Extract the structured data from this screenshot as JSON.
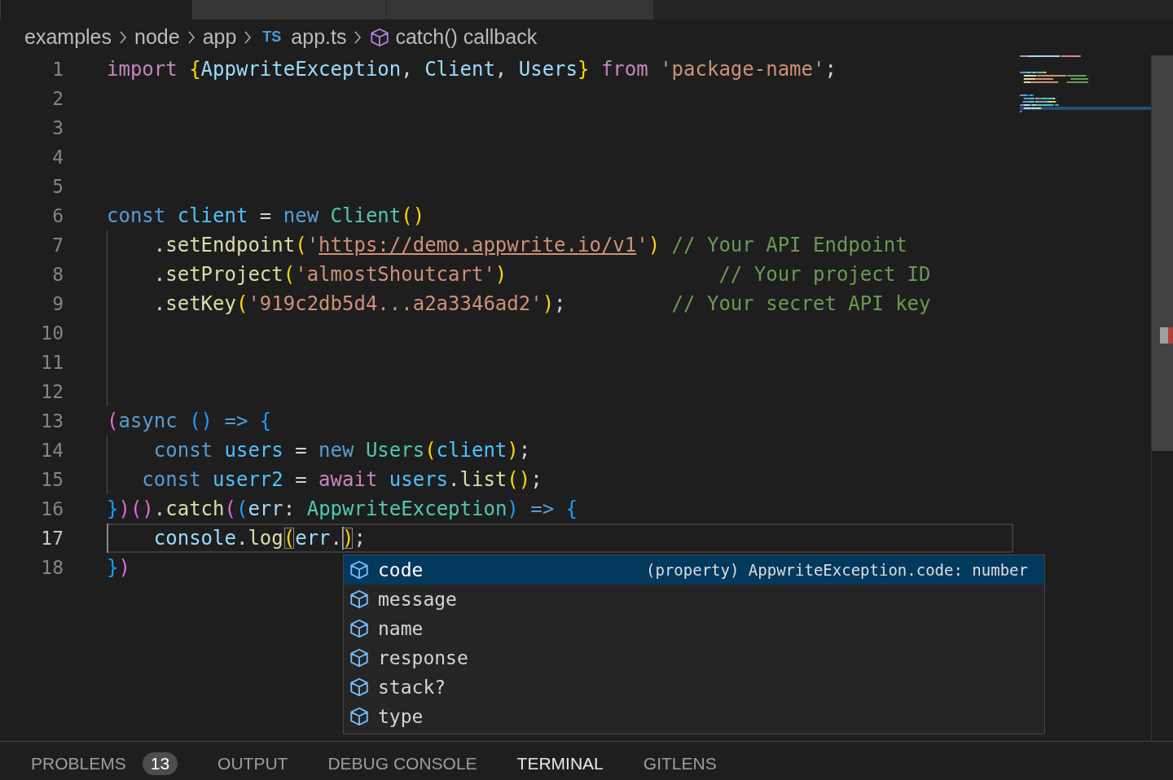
{
  "editor_tabs": [
    {
      "selected": true
    },
    {
      "selected": false
    },
    {
      "selected": false
    }
  ],
  "breadcrumb": [
    {
      "kind": "folder",
      "label": "examples"
    },
    {
      "kind": "folder",
      "label": "node"
    },
    {
      "kind": "folder",
      "label": "app"
    },
    {
      "kind": "file",
      "badge": "TS",
      "label": "app.ts"
    },
    {
      "kind": "symbol",
      "label": "catch() callback"
    }
  ],
  "editor": {
    "lines": [
      {
        "number": "1",
        "current": false,
        "guide": false,
        "tokens": [
          {
            "t": "import ",
            "color": "#c586c0"
          },
          {
            "t": "{",
            "color": "#ffd700"
          },
          {
            "t": "AppwriteException",
            "color": "#9cdcfe"
          },
          {
            "t": ", ",
            "color": "#d4d4d4"
          },
          {
            "t": "Client",
            "color": "#9cdcfe"
          },
          {
            "t": ", ",
            "color": "#d4d4d4"
          },
          {
            "t": "Users",
            "color": "#9cdcfe"
          },
          {
            "t": "}",
            "color": "#ffd700"
          },
          {
            "t": " from ",
            "color": "#c586c0"
          },
          {
            "t": "'package-name'",
            "color": "#ce9178"
          },
          {
            "t": ";",
            "color": "#d4d4d4"
          }
        ]
      },
      {
        "number": "2",
        "current": false,
        "guide": false
      },
      {
        "number": "3",
        "current": false,
        "guide": false
      },
      {
        "number": "4",
        "current": false,
        "guide": false
      },
      {
        "number": "5",
        "current": false,
        "guide": false
      },
      {
        "number": "6",
        "current": false,
        "guide": false,
        "tokens": [
          {
            "t": "const ",
            "color": "#569cd6"
          },
          {
            "t": "client",
            "color": "#4fc1ff"
          },
          {
            "t": " = ",
            "color": "#d4d4d4"
          },
          {
            "t": "new ",
            "color": "#569cd6"
          },
          {
            "t": "Client",
            "color": "#4ec9b0"
          },
          {
            "t": "()",
            "color": "#ffd700"
          }
        ]
      },
      {
        "number": "7",
        "current": false,
        "guide": true,
        "tokens": [
          {
            "t": "    .setEndpoint",
            "color": "#dcdcaa"
          },
          {
            "t": "(",
            "color": "#ffd700"
          },
          {
            "t": "'",
            "color": "#ce9178"
          },
          {
            "t": "https://demo.appwrite.io/v1",
            "color": "#ce9178",
            "underline": true
          },
          {
            "t": "'",
            "color": "#ce9178"
          },
          {
            "t": ")",
            "color": "#ffd700"
          },
          {
            "t": " // Your API Endpoint",
            "color": "#6a9955"
          }
        ]
      },
      {
        "number": "8",
        "current": false,
        "guide": true,
        "tokens": [
          {
            "t": "    .setProject",
            "color": "#dcdcaa"
          },
          {
            "t": "(",
            "color": "#ffd700"
          },
          {
            "t": "'almostShoutcart'",
            "color": "#ce9178"
          },
          {
            "t": ")",
            "color": "#ffd700"
          },
          {
            "t": "                  // Your project ID",
            "color": "#6a9955"
          }
        ]
      },
      {
        "number": "9",
        "current": false,
        "guide": true,
        "tokens": [
          {
            "t": "    .setKey",
            "color": "#dcdcaa"
          },
          {
            "t": "(",
            "color": "#ffd700"
          },
          {
            "t": "'919c2db5d4...a2a3346ad2'",
            "color": "#ce9178"
          },
          {
            "t": ")",
            "color": "#ffd700"
          },
          {
            "t": ";",
            "color": "#d4d4d4"
          },
          {
            "t": "         // Your secret API key",
            "color": "#6a9955"
          }
        ]
      },
      {
        "number": "10",
        "current": false,
        "guide": true
      },
      {
        "number": "11",
        "current": false,
        "guide": true
      },
      {
        "number": "12",
        "current": false,
        "guide": true
      },
      {
        "number": "13",
        "current": false,
        "guide": false,
        "tokens": [
          {
            "t": "(",
            "color": "#da70d6"
          },
          {
            "t": "async ",
            "color": "#569cd6"
          },
          {
            "t": "()",
            "color": "#179fff"
          },
          {
            "t": " => ",
            "color": "#569cd6"
          },
          {
            "t": "{",
            "color": "#179fff"
          }
        ]
      },
      {
        "number": "14",
        "current": false,
        "guide": true,
        "tokens": [
          {
            "t": "    const ",
            "color": "#569cd6"
          },
          {
            "t": "users",
            "color": "#4fc1ff"
          },
          {
            "t": " = ",
            "color": "#d4d4d4"
          },
          {
            "t": "new ",
            "color": "#569cd6"
          },
          {
            "t": "Users",
            "color": "#4ec9b0"
          },
          {
            "t": "(",
            "color": "#ffd700"
          },
          {
            "t": "client",
            "color": "#4fc1ff"
          },
          {
            "t": ")",
            "color": "#ffd700"
          },
          {
            "t": ";",
            "color": "#d4d4d4"
          }
        ]
      },
      {
        "number": "15",
        "current": false,
        "guide": true,
        "tokens": [
          {
            "t": "   const ",
            "color": "#569cd6"
          },
          {
            "t": "userr2",
            "color": "#4fc1ff"
          },
          {
            "t": " = ",
            "color": "#d4d4d4"
          },
          {
            "t": "await ",
            "color": "#c586c0"
          },
          {
            "t": "users",
            "color": "#4fc1ff"
          },
          {
            "t": ".",
            "color": "#d4d4d4"
          },
          {
            "t": "list",
            "color": "#dcdcaa"
          },
          {
            "t": "()",
            "color": "#ffd700"
          },
          {
            "t": ";",
            "color": "#d4d4d4"
          }
        ]
      },
      {
        "number": "16",
        "current": false,
        "guide": false,
        "tokens": [
          {
            "t": "}",
            "color": "#179fff"
          },
          {
            "t": ")()",
            "color": "#da70d6"
          },
          {
            "t": ".",
            "color": "#d4d4d4"
          },
          {
            "t": "catch",
            "color": "#dcdcaa"
          },
          {
            "t": "(",
            "color": "#da70d6"
          },
          {
            "t": "(",
            "color": "#179fff"
          },
          {
            "t": "err",
            "color": "#9cdcfe"
          },
          {
            "t": ": ",
            "color": "#d4d4d4"
          },
          {
            "t": "AppwriteException",
            "color": "#4ec9b0"
          },
          {
            "t": ")",
            "color": "#179fff"
          },
          {
            "t": " => ",
            "color": "#569cd6"
          },
          {
            "t": "{",
            "color": "#179fff"
          }
        ]
      },
      {
        "number": "17",
        "current": true,
        "guide": true,
        "tokens": [
          {
            "t": "    console",
            "color": "#9cdcfe"
          },
          {
            "t": ".",
            "color": "#d4d4d4"
          },
          {
            "t": "log",
            "color": "#dcdcaa"
          },
          {
            "t": "(",
            "color": "#ffd700",
            "matched": true
          },
          {
            "t": "err",
            "color": "#9cdcfe"
          },
          {
            "t": ".",
            "color": "#d4d4d4"
          },
          {
            "t": ")",
            "color": "#ffd700",
            "matched": true
          },
          {
            "t": ";",
            "color": "#d4d4d4"
          }
        ]
      },
      {
        "number": "18",
        "current": false,
        "guide": false,
        "tokens": [
          {
            "t": "}",
            "color": "#179fff"
          },
          {
            "t": ")",
            "color": "#da70d6"
          }
        ]
      }
    ]
  },
  "suggestions": [
    {
      "label": "code",
      "selected": true,
      "detail": "(property) AppwriteException.code: number"
    },
    {
      "label": "message",
      "selected": false
    },
    {
      "label": "name",
      "selected": false
    },
    {
      "label": "response",
      "selected": false
    },
    {
      "label": "stack?",
      "selected": false
    },
    {
      "label": "type",
      "selected": false
    }
  ],
  "panel": {
    "tabs": [
      {
        "label": "PROBLEMS",
        "selected": false,
        "badge": "13"
      },
      {
        "label": "OUTPUT",
        "selected": false
      },
      {
        "label": "DEBUG CONSOLE",
        "selected": false
      },
      {
        "label": "TERMINAL",
        "selected": true
      },
      {
        "label": "GITLENS",
        "selected": false
      }
    ]
  }
}
